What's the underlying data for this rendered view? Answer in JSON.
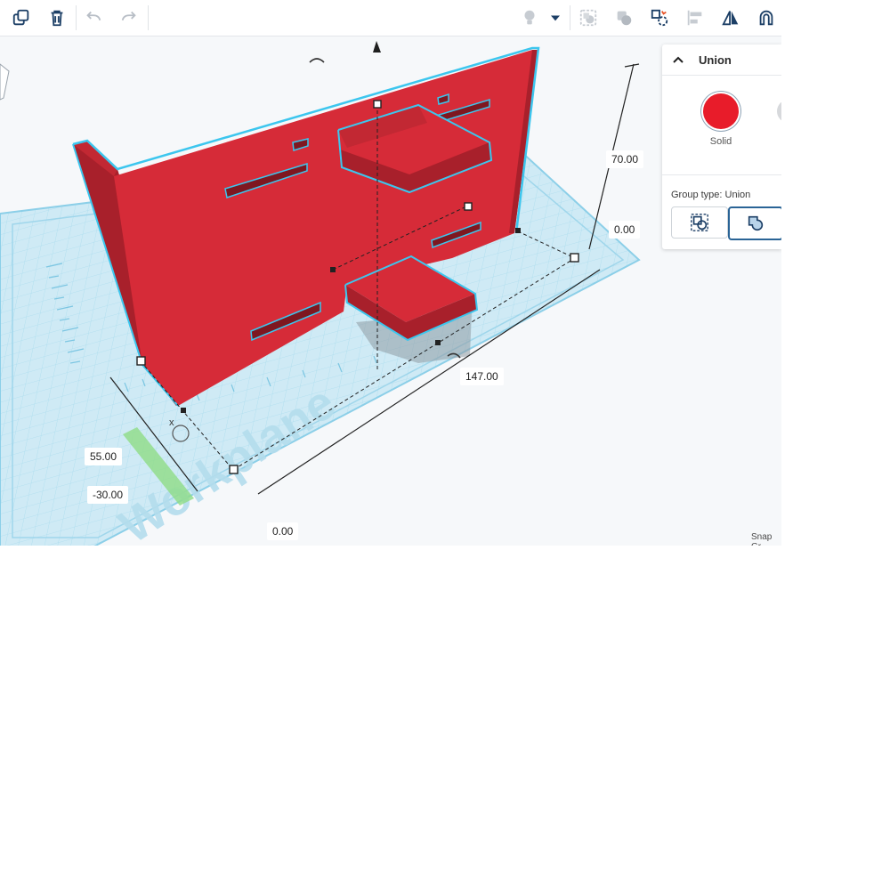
{
  "toolbar": {
    "left": [
      "copy-icon",
      "trash-icon",
      "undo-icon",
      "redo-icon"
    ],
    "right": [
      "lightbulb-icon",
      "dropdown-caret-icon",
      "group-icon",
      "ungroup-icon",
      "snap-icon",
      "align-icon",
      "mirror-icon",
      "magnet-icon"
    ]
  },
  "dimensions": {
    "height": "70.00",
    "elevation": "0.00",
    "length": "147.00",
    "width": "55.00",
    "offset_y": "-30.00",
    "offset_x": "0.00"
  },
  "inspector": {
    "title": "Union",
    "solid_label": "Solid",
    "group_type_label": "Group type: Union"
  },
  "workplane": {
    "watermark": "Workplane",
    "axis_label": "x"
  },
  "snap_grid": "Snap Gr",
  "colors": {
    "solid": "#e81c2a",
    "shape_front": "#d62b38",
    "shape_side": "#a8202b",
    "selection_outline": "#3cc6ee",
    "grid": "#cfeaf5",
    "grid_line": "#8ccfe8"
  }
}
